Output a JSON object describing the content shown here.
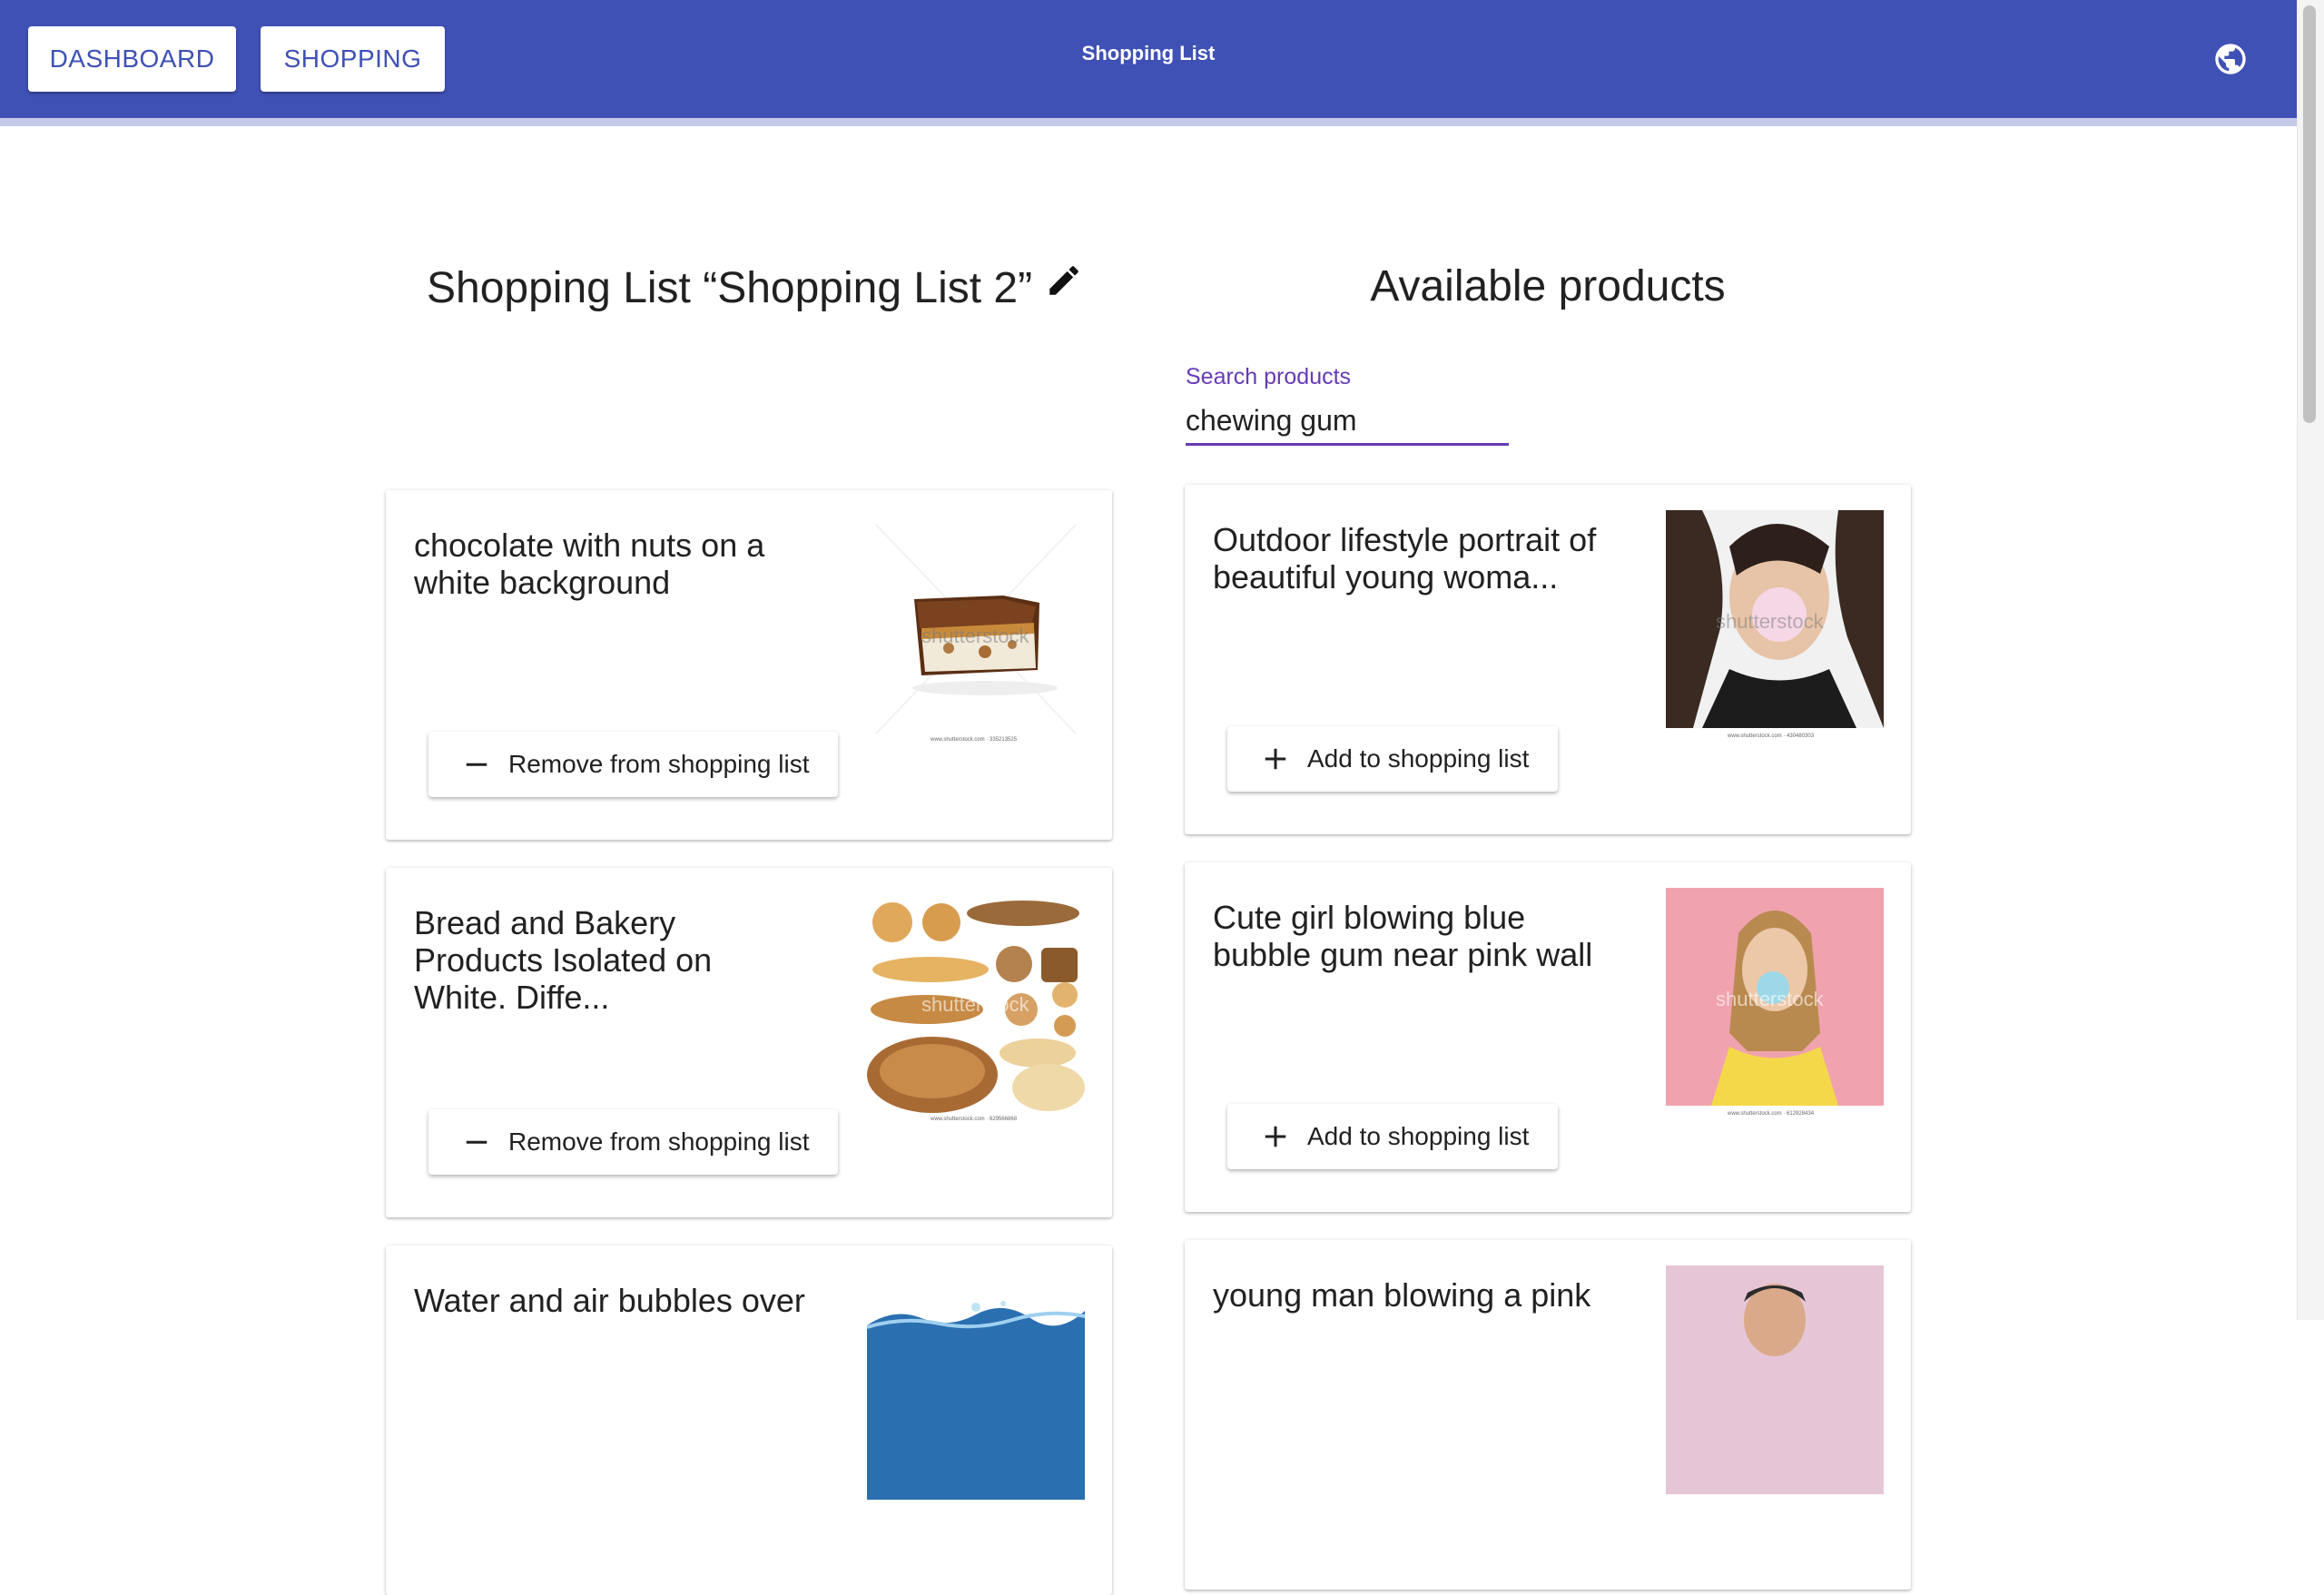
{
  "appbar": {
    "dashboard_label": "DASHBOARD",
    "shopping_label": "SHOPPING",
    "title": "Shopping List",
    "language_icon": "globe-icon"
  },
  "shopping_list": {
    "heading": "Shopping List “Shopping List 2”",
    "edit_icon": "pencil-icon",
    "items": [
      {
        "title": "chocolate with nuts on a white background",
        "button_label": "Remove from shopping list",
        "image": "chocolate-bar-image"
      },
      {
        "title": "Bread and Bakery Products Isolated on White. Diffe...",
        "button_label": "Remove from shopping list",
        "image": "bakery-products-image"
      },
      {
        "title": "Water and air bubbles over",
        "image": "water-bubbles-image"
      }
    ]
  },
  "available": {
    "heading": "Available products",
    "search": {
      "label": "Search products",
      "value": "chewing gum"
    },
    "items": [
      {
        "title": "Outdoor lifestyle portrait of beautiful young woma...",
        "button_label": "Add to shopping list",
        "image": "woman-bubble-gum-image"
      },
      {
        "title": "Cute girl blowing blue bubble gum near pink wall",
        "button_label": "Add to shopping list",
        "image": "girl-blue-bubble-image"
      },
      {
        "title": "young man blowing a pink",
        "image": "man-pink-bubble-image"
      }
    ]
  },
  "colors": {
    "primary": "#3f51b5",
    "accent": "#673ab7",
    "progress": "#c5cae9"
  },
  "watermark": "shutterstock"
}
